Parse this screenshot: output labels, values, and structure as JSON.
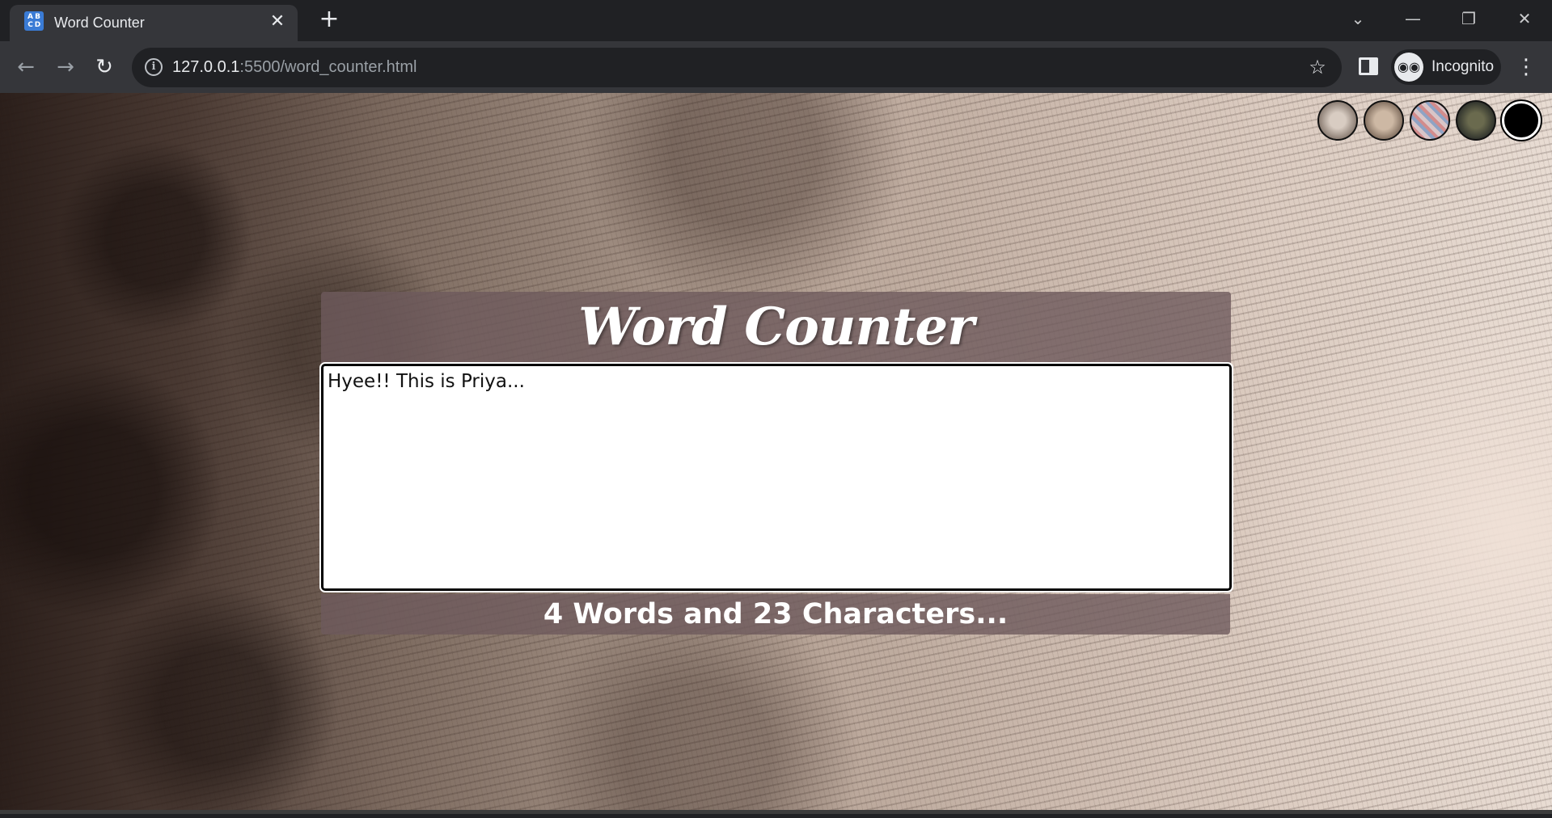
{
  "browser": {
    "tab_title": "Word Counter",
    "favicon_letters": [
      "A",
      "B",
      "C",
      "D"
    ],
    "url_host": "127.0.0.1",
    "url_rest": ":5500/word_counter.html",
    "profile_label": "Incognito",
    "icons": {
      "tab_close": "✕",
      "new_tab": "+",
      "tab_search": "⌄",
      "minimize": "—",
      "restore": "❐",
      "window_close": "✕",
      "back": "←",
      "forward": "→",
      "reload": "↻",
      "info": "i",
      "star": "☆",
      "menu": "⋮",
      "incognito": "◉◉"
    }
  },
  "app": {
    "title": "Word Counter",
    "textarea_value": "Hyee!! This is Priya...",
    "count_text": "4 Words and 23 Characters...",
    "themes": [
      "theme-1",
      "theme-2",
      "theme-3",
      "theme-4",
      "theme-5"
    ]
  },
  "colors": {
    "panel": "#6e5a5d",
    "title_text": "#ffffff",
    "chrome_dark": "#202124",
    "chrome_mid": "#35363a"
  }
}
